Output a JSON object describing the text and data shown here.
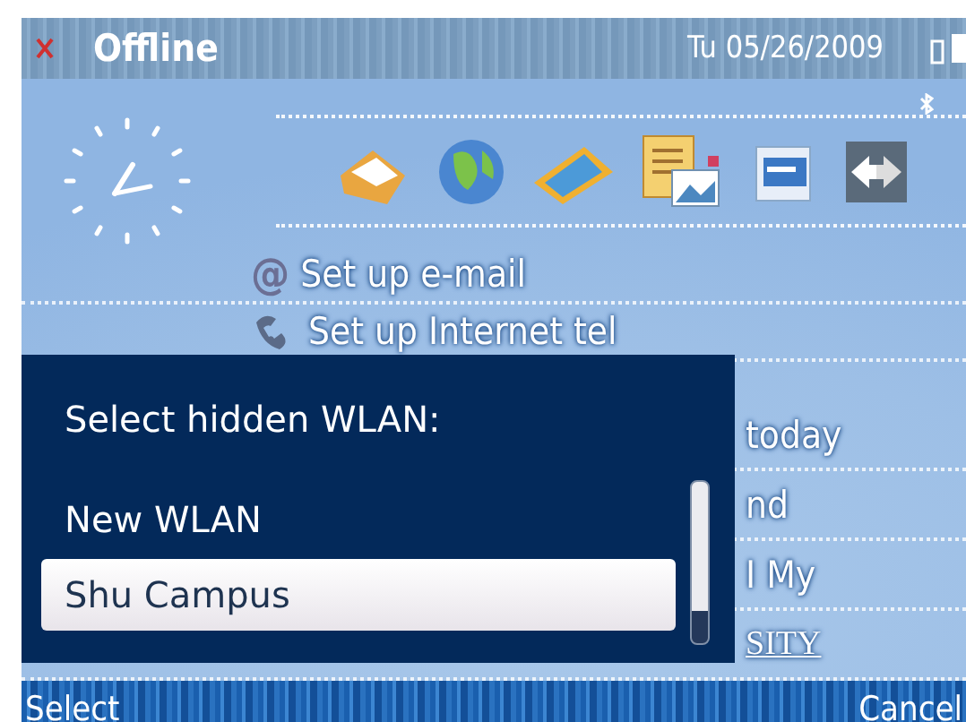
{
  "status_bar": {
    "title": "Offline",
    "date": "Tu 05/26/2009"
  },
  "home": {
    "shortcuts": [
      {
        "kind": "mail"
      },
      {
        "kind": "globe"
      },
      {
        "kind": "photos"
      },
      {
        "kind": "document"
      },
      {
        "kind": "files"
      },
      {
        "kind": "switch"
      }
    ],
    "items": [
      {
        "kind": "glyph",
        "glyph": "@",
        "text": "Set up e-mail"
      },
      {
        "kind": "icon",
        "text": "Set up Internet tel"
      },
      {
        "kind": "partial",
        "text": "today"
      },
      {
        "kind": "partial",
        "text": "nd"
      },
      {
        "kind": "partial",
        "text": "I My"
      },
      {
        "kind": "link",
        "text": "SITY"
      }
    ]
  },
  "dialog": {
    "title": "Select hidden WLAN:",
    "items": [
      {
        "label": "New WLAN",
        "selected": false
      },
      {
        "label": "Shu Campus",
        "selected": true
      }
    ]
  },
  "softkeys": {
    "left": "Select",
    "right": "Cancel"
  }
}
